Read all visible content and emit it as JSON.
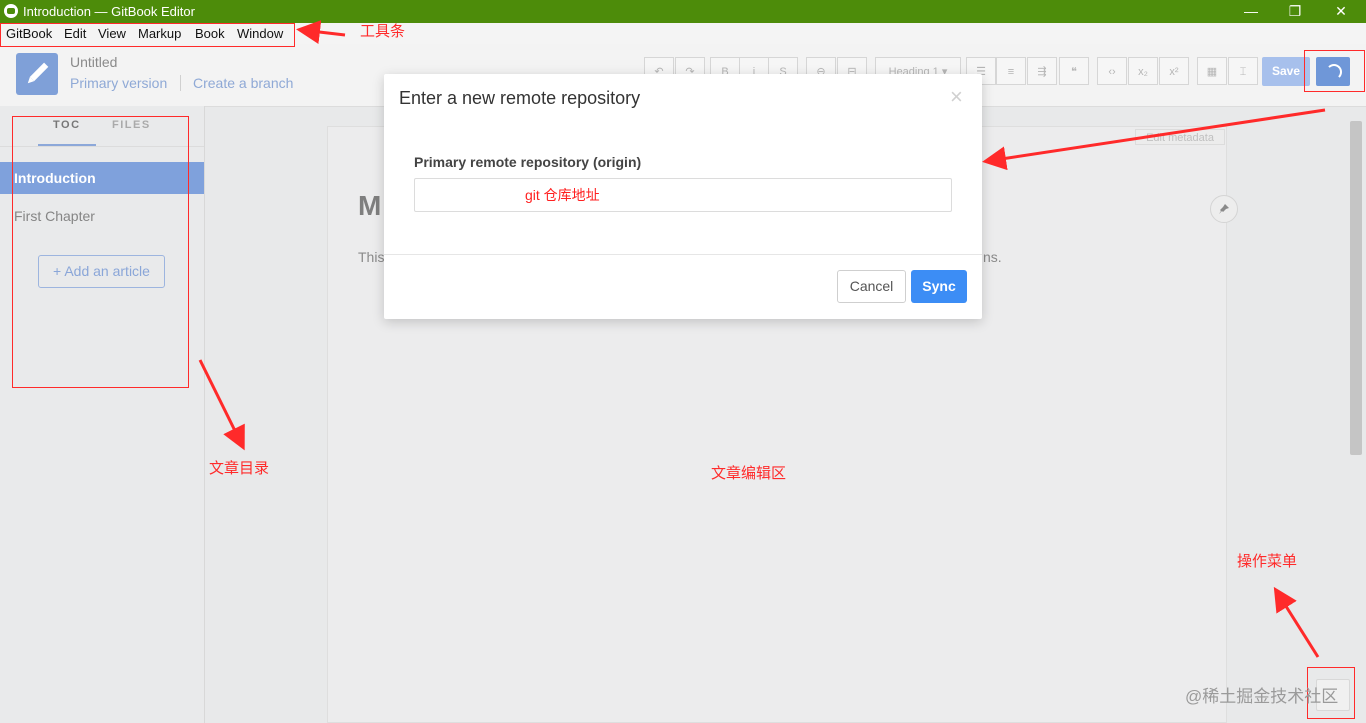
{
  "window": {
    "title": "Introduction — GitBook Editor",
    "controls": [
      "—",
      "❐",
      "✕"
    ]
  },
  "menubar": {
    "items": [
      "GitBook",
      "Edit",
      "View",
      "Markup",
      "Book",
      "Window"
    ]
  },
  "header": {
    "book_title": "Untitled",
    "version_link": "Primary version",
    "branch_link": "Create a branch",
    "toolbar_buttons": [
      "↶",
      "↷",
      "B",
      "i",
      "S",
      "⊖",
      "⊟",
      "Heading 1 ▾",
      "☰",
      "≡",
      "⇶",
      "❝",
      "‹›",
      "x₂",
      "x²",
      "▦",
      "⌶"
    ],
    "save_label": "Save"
  },
  "sidebar": {
    "tabs": [
      "TOC",
      "FILES"
    ],
    "active_tab": "TOC",
    "items": [
      "Introduction",
      "First Chapter"
    ],
    "add_article_label": "+ Add an article"
  },
  "editor": {
    "edit_metadata_label": "Edit metadata",
    "heading_fragment": "M",
    "body_fragment_left": "This",
    "body_fragment_right": "ns.",
    "pin_icon": "📌"
  },
  "modal": {
    "title": "Enter a new remote repository",
    "close_symbol": "×",
    "field_label": "Primary remote repository (origin)",
    "input_value": "git 仓库地址",
    "cancel_label": "Cancel",
    "sync_label": "Sync"
  },
  "annotations": {
    "toolbar": "工具条",
    "toc": "文章目录",
    "editor_area": "文章编辑区",
    "operation_menu": "操作菜单",
    "color": "#ff2a2a"
  },
  "watermark": "@稀土掘金技术社区",
  "colors": {
    "titlebar": "#4d8c0a",
    "accent": "#7fa1dc",
    "sync_button": "#3c8df5"
  }
}
